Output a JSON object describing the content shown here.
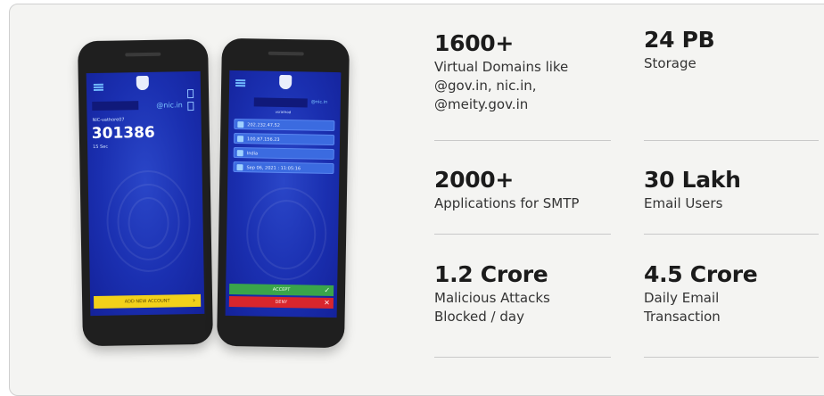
{
  "phone_left": {
    "brand_label": "@nic.in",
    "account_label": "NIC-vathore07",
    "otp_code": "301386",
    "otp_timer": "15 Sec",
    "add_button_label": "ADD NEW ACCOUNT"
  },
  "phone_right": {
    "brand_label": "@nic.in",
    "user_label": "vsrathod",
    "info_rows": [
      "202.232.47.52",
      "100.87.156.23",
      "India",
      "Sep 06, 2021 : 11:05:16"
    ],
    "accept_label": "ACCEPT",
    "deny_label": "DENY"
  },
  "stats": [
    {
      "value": "1600+",
      "desc_lines": [
        "Virtual Domains like",
        "@gov.in, nic.in,",
        "@meity.gov.in"
      ]
    },
    {
      "value": "24 PB",
      "desc_lines": [
        "Storage"
      ]
    },
    {
      "value": "2000+",
      "desc_lines": [
        "Applications for SMTP"
      ]
    },
    {
      "value": "30 Lakh",
      "desc_lines": [
        "Email Users"
      ]
    },
    {
      "value": "1.2 Crore",
      "desc_lines": [
        "Malicious Attacks",
        "Blocked / day"
      ]
    },
    {
      "value": "4.5 Crore",
      "desc_lines": [
        "Daily Email",
        "Transaction"
      ]
    }
  ],
  "colors": {
    "screen_blue": "#1a2fb0",
    "add_button": "#f2d11a",
    "accept": "#3aa54a",
    "deny": "#d8262d"
  }
}
